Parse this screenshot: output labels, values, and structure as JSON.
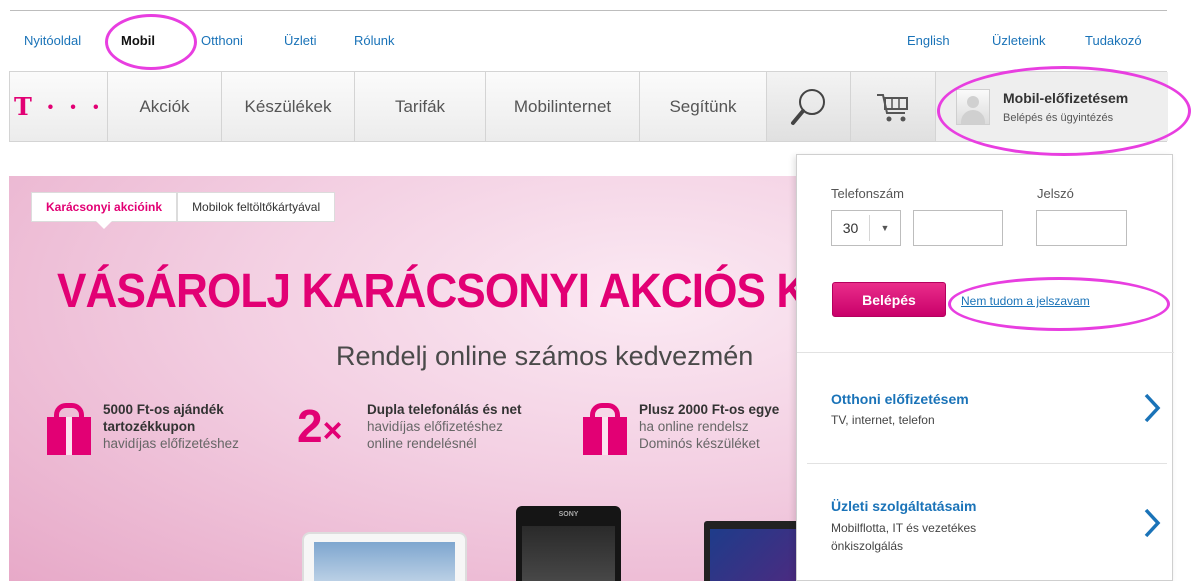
{
  "top_nav": {
    "left": [
      "Nyitóoldal",
      "Mobil",
      "Otthoni",
      "Üzleti",
      "Rólunk"
    ],
    "active": "Mobil",
    "right": [
      "English",
      "Üzleteink",
      "Tudakozó"
    ]
  },
  "main_nav": {
    "logo": "T · · ·",
    "items": [
      "Akciók",
      "Készülékek",
      "Tarifák",
      "Mobilinternet",
      "Segítünk"
    ],
    "search_icon": "search-icon",
    "cart_icon": "cart-icon"
  },
  "account": {
    "title": "Mobil-előfizetésem",
    "subtitle": "Belépés és ügyintézés",
    "avatar_icon": "user-avatar-icon"
  },
  "hero": {
    "tabs": [
      "Karácsonyi akcióink",
      "Mobilok feltöltőkártyával"
    ],
    "active_tab": "Karácsonyi akcióink",
    "headline": "VÁSÁROLJ KARÁCSONYI AKCIÓS KÉ",
    "subheadline": "Rendelj online számos kedvezmén",
    "promos": [
      {
        "icon": "gift-icon",
        "title": "5000 Ft-os ajándék tartozékkupon",
        "title_line1": "5000 Ft-os ajándék",
        "title_line2": "tartozékkupon",
        "desc": "havidíjas előfizetéshez"
      },
      {
        "icon": "2x",
        "title": "Dupla telefonálás és net",
        "desc_line1": "havidíjas előfizetéshez",
        "desc_line2": "online rendelésnél"
      },
      {
        "icon": "gift-icon",
        "title": "Plusz 2000 Ft-os egye",
        "desc_line1": "ha online rendelsz",
        "desc_line2": "Dominós készüléket"
      }
    ],
    "phone_brand": "SONY"
  },
  "login": {
    "phone_label": "Telefonszám",
    "password_label": "Jelszó",
    "prefix_value": "30",
    "phone_value": "",
    "password_value": "",
    "submit_label": "Belépés",
    "forgot_link": "Nem tudom a jelszavam"
  },
  "services": [
    {
      "title": "Otthoni előfizetésem",
      "subtitle": "TV, internet, telefon"
    },
    {
      "title": "Üzleti szolgáltatásaim",
      "subtitle_line1": "Mobilflotta, IT és vezetékes",
      "subtitle_line2": "önkiszolgálás"
    }
  ],
  "colors": {
    "brand_magenta": "#e20074",
    "link_blue": "#1a73b8",
    "annotation_circle": "#e83ee0"
  }
}
